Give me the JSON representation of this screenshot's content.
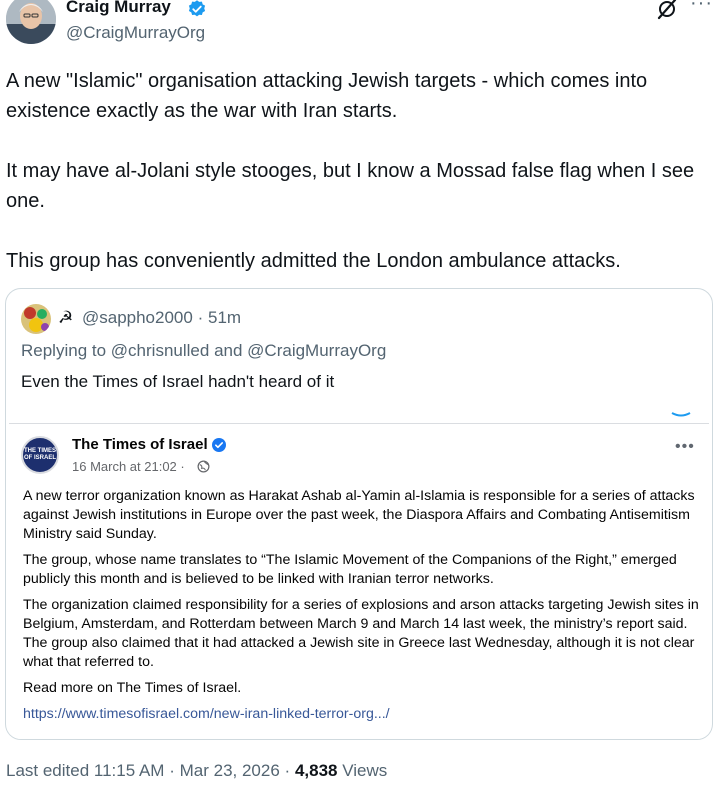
{
  "author": {
    "name": "Craig Murray",
    "handle": "@CraigMurrayOrg"
  },
  "header_icons": [
    "grok-icon",
    "more-icon"
  ],
  "tweet_paragraphs": [
    "A new \"Islamic\" organisation attacking Jewish targets - which comes into existence exactly as the war with Iran starts.",
    "It may have al-Jolani style stooges, but I know a Mossad false flag when I see one.",
    "This group has conveniently admitted the London ambulance attacks."
  ],
  "quote": {
    "user_emoji": "☭",
    "handle": "@sappho2000",
    "separator": "·",
    "time": "51m",
    "reply_prefix": "Replying to",
    "reply_user_1": "@chrisnulled",
    "reply_and": "and",
    "reply_user_2": "@CraigMurrayOrg",
    "text": "Even the Times of Israel hadn't heard of it",
    "embedded_post": {
      "logo_text": "THE TIMES OF ISRAEL",
      "page_name": "The Times of Israel",
      "date": "16 March at 21:02 ·",
      "paragraphs": [
        "A new terror organization known as Harakat Ashab al-Yamin al-Islamia is responsible for a series of attacks against Jewish institutions in Europe over the past week, the Diaspora Affairs and Combating Antisemitism Ministry said Sunday.",
        "The group, whose name translates to “The Islamic Movement of the Companions of the Right,” emerged publicly this month and is believed to be linked with Iranian terror networks.",
        "The organization claimed responsibility for a series of explosions and arson attacks targeting Jewish sites in Belgium, Amsterdam, and Rotterdam between March 9 and March 14 last week, the ministry’s report said. The group also claimed that it had attacked a Jewish site in Greece last Wednesday, although it is not clear what that referred to.",
        "Read more on The Times of Israel."
      ],
      "link": "https://www.timesofisrael.com/new-iran-linked-terror-org.../"
    }
  },
  "meta": {
    "edited": "Last edited 11:15 AM",
    "date": "Mar 23, 2026",
    "views_count": "4,838",
    "views_label": "Views"
  },
  "colors": {
    "text": "#0f1419",
    "secondary": "#536471",
    "verified": "#1d9bf0",
    "border": "#cfd9de",
    "fb_link": "#385898"
  }
}
